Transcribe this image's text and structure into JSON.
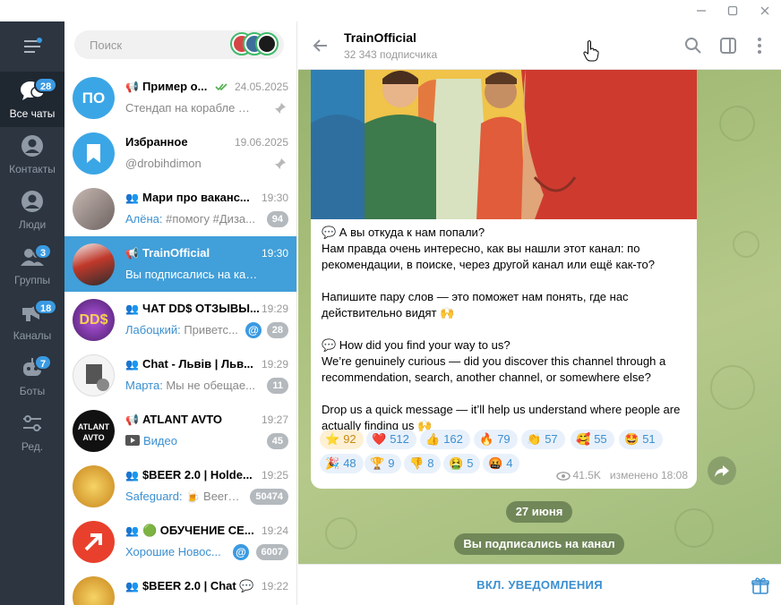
{
  "rail": {
    "items": [
      {
        "label": "Все чаты",
        "badge": "28",
        "icon": "chat-bubbles-icon",
        "active": true
      },
      {
        "label": "Контакты",
        "badge": "",
        "icon": "contact-icon"
      },
      {
        "label": "Люди",
        "badge": "",
        "icon": "person-icon"
      },
      {
        "label": "Группы",
        "badge": "3",
        "icon": "group-icon"
      },
      {
        "label": "Каналы",
        "badge": "18",
        "icon": "channel-icon"
      },
      {
        "label": "Боты",
        "badge": "7",
        "icon": "bot-icon"
      },
      {
        "label": "Ред.",
        "badge": "",
        "icon": "edit-filters-icon"
      }
    ]
  },
  "search": {
    "placeholder": "Поиск"
  },
  "chats": [
    {
      "prefix": "📢",
      "name": "Пример о...",
      "time": "24.05.2025",
      "preview": "Стендап на корабле — ...",
      "sender": "",
      "badge": "",
      "avatar_text": "ПО",
      "avatar_color": "#3ba6e6",
      "pinned": true,
      "read": true
    },
    {
      "prefix": "",
      "name": "Избранное",
      "time": "19.06.2025",
      "preview": "@drobihdimon",
      "sender": "",
      "badge": "",
      "avatar_text": "",
      "avatar_color": "#3ba6e6",
      "pinned": true
    },
    {
      "prefix": "👥",
      "name": "Мари про ваканс...",
      "time": "19:30",
      "preview": "#помогу #Диза...",
      "sender": "Алёна: ",
      "badge": "94",
      "avatar_color": "#8b7d7a"
    },
    {
      "prefix": "📢",
      "name": "TrainOfficial",
      "time": "19:30",
      "preview": "Вы подписались на канал",
      "sender": "",
      "badge": "",
      "avatar_color": "#c0392b",
      "active": true
    },
    {
      "prefix": "👥",
      "name": "ЧАТ DD$ ОТЗЫВЫ...",
      "time": "19:29",
      "preview": "Приветс...",
      "sender": "Лабоцкий: ",
      "badge": "28",
      "mention": true,
      "avatar_color": "#7b3fa0"
    },
    {
      "prefix": "👥",
      "name": "Chat - Львів | Льв...",
      "time": "19:29",
      "preview": "Мы не обещае...",
      "sender": "Марта: ",
      "badge": "11",
      "avatar_color": "#f2f2f2"
    },
    {
      "prefix": "📢",
      "name": "ATLANT AVTO",
      "time": "19:27",
      "preview": "Видео",
      "sender": "",
      "badge": "45",
      "avatar_color": "#111111",
      "avatar_text": "ATLANT AVTO"
    },
    {
      "prefix": "👥",
      "name": "$BEER 2.0 | Holde...",
      "time": "19:25",
      "preview": "🍺 Beergc...",
      "sender": "Safeguard: ",
      "badge": "50474",
      "avatar_color": "#f1c232"
    },
    {
      "prefix": "👥",
      "name": "🟢 ОБУЧЕНИЕ СЕ...",
      "time": "19:24",
      "preview": "Хорошие Новос...",
      "sender": "",
      "badge": "6007",
      "mention": true,
      "avatar_color": "#e8402c"
    },
    {
      "prefix": "👥",
      "name": "$BEER 2.0 | Chat 💬",
      "time": "19:22",
      "preview": "...",
      "sender": "",
      "badge": "",
      "avatar_color": "#f1c232"
    }
  ],
  "header": {
    "title": "TrainOfficial",
    "subtitle": "32 343 подписчика"
  },
  "message": {
    "text": "💬 А вы откуда к нам попали?\nНам правда очень интересно, как вы нашли этот канал: по рекомендации, в поиске, через другой канал или ещё как-то?\n\nНапишите пару слов — это поможет нам понять, где нас действительно видят 🙌\n\n💬 How did you find your way to us?\nWe’re genuinely curious — did you discover this channel through a recommendation, search, another channel, or somewhere else?\n\nDrop us a quick message — it’ll help us understand where people are actually finding us 🙌",
    "reactions": [
      {
        "emoji": "⭐",
        "count": "92"
      },
      {
        "emoji": "❤️",
        "count": "512"
      },
      {
        "emoji": "👍",
        "count": "162"
      },
      {
        "emoji": "🔥",
        "count": "79"
      },
      {
        "emoji": "👏",
        "count": "57"
      },
      {
        "emoji": "🥰",
        "count": "55"
      },
      {
        "emoji": "🤩",
        "count": "51"
      },
      {
        "emoji": "🎉",
        "count": "48"
      },
      {
        "emoji": "🏆",
        "count": "9"
      },
      {
        "emoji": "👎",
        "count": "8"
      },
      {
        "emoji": "🤮",
        "count": "5"
      },
      {
        "emoji": "🤬",
        "count": "4"
      }
    ],
    "views": "41.5K",
    "edited": "изменено 18:08"
  },
  "date_pill": "27 июня",
  "service_pill": "Вы подписались на канал",
  "bottom": {
    "notify_label": "ВКЛ. УВЕДОМЛЕНИЯ"
  },
  "colors": {
    "accent": "#3b8fd0",
    "active_chat": "#419fd9",
    "rail": "#2c3540",
    "badge": "#3a9ae2"
  }
}
